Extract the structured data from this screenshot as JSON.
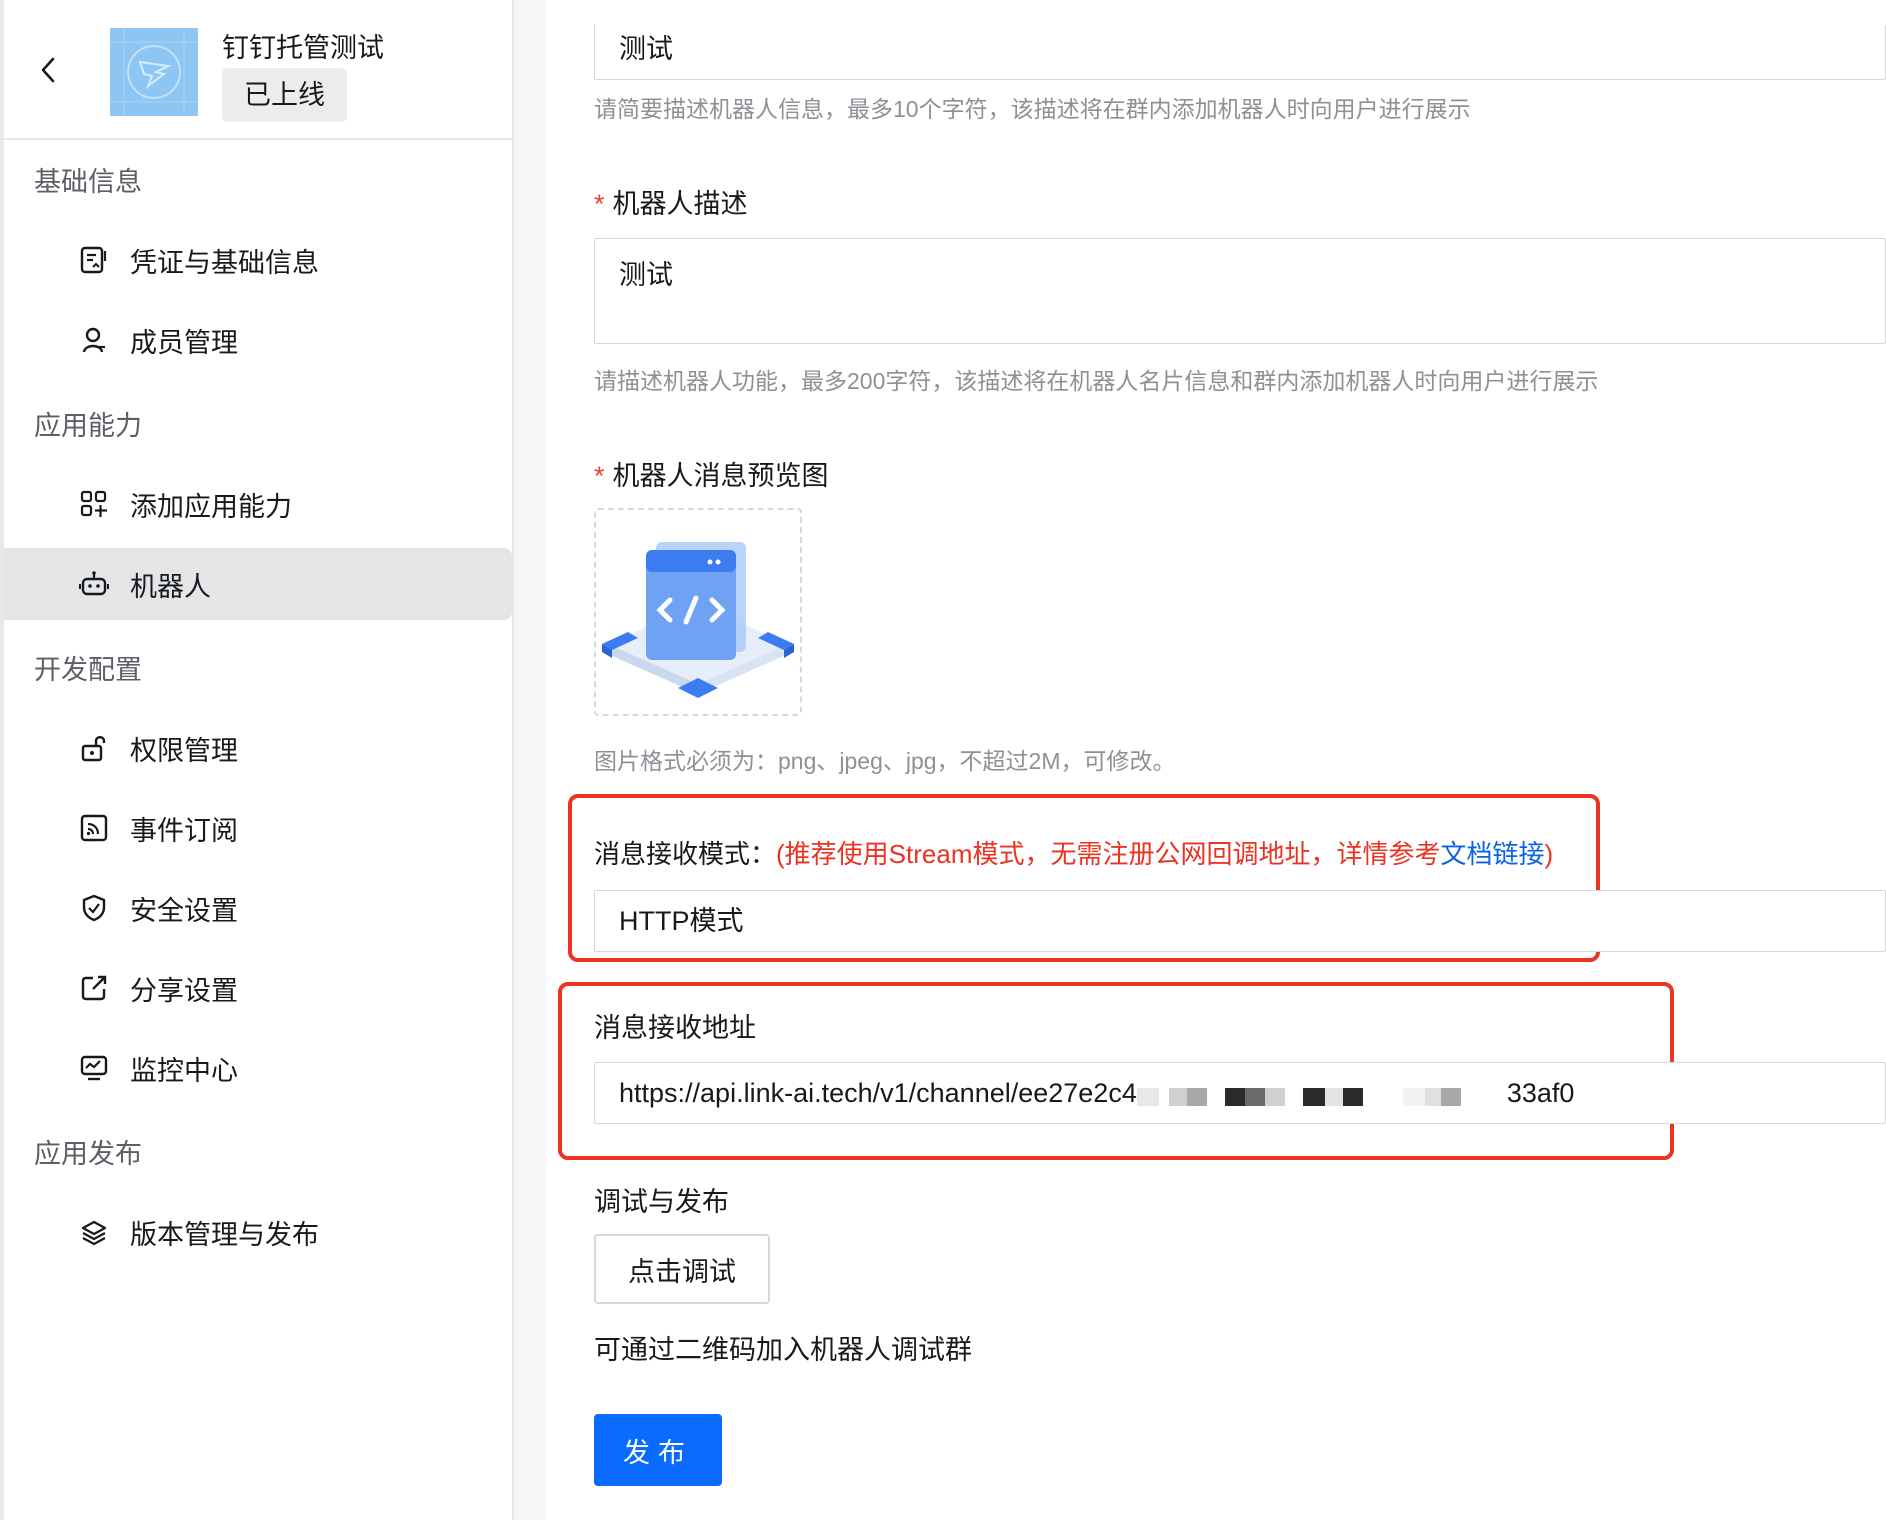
{
  "app": {
    "name": "钉钉托管测试",
    "status": "已上线"
  },
  "sidebar": {
    "sections": [
      {
        "title": "基础信息",
        "items": [
          {
            "label": "凭证与基础信息",
            "icon": "credential-icon"
          },
          {
            "label": "成员管理",
            "icon": "user-icon"
          }
        ]
      },
      {
        "title": "应用能力",
        "items": [
          {
            "label": "添加应用能力",
            "icon": "apps-add-icon"
          },
          {
            "label": "机器人",
            "icon": "robot-icon"
          }
        ]
      },
      {
        "title": "开发配置",
        "items": [
          {
            "label": "权限管理",
            "icon": "lock-icon"
          },
          {
            "label": "事件订阅",
            "icon": "rss-icon"
          },
          {
            "label": "安全设置",
            "icon": "shield-icon"
          },
          {
            "label": "分享设置",
            "icon": "share-icon"
          },
          {
            "label": "监控中心",
            "icon": "monitor-icon"
          }
        ]
      },
      {
        "title": "应用发布",
        "items": [
          {
            "label": "版本管理与发布",
            "icon": "layers-icon"
          }
        ]
      }
    ],
    "active": "机器人"
  },
  "form": {
    "brief_value": "测试",
    "brief_hint": "请简要描述机器人信息，最多10个字符，该描述将在群内添加机器人时向用户进行展示",
    "desc_label": "机器人描述",
    "desc_value": "测试",
    "desc_hint": "请描述机器人功能，最多200字符，该描述将在机器人名片信息和群内添加机器人时向用户进行展示",
    "preview_label": "机器人消息预览图",
    "preview_hint": "图片格式必须为：png、jpeg、jpg，不超过2M，可修改。",
    "mode_label": "消息接收模式：",
    "mode_note_prefix": "(推荐使用Stream模式，无需注册公网回调地址，详情参考",
    "mode_note_link": "文档链接",
    "mode_note_suffix": ")",
    "mode_value": "HTTP模式",
    "url_label": "消息接收地址",
    "url_value_start": "https://api.link-ai.tech/v1/channel/ee27e2c4",
    "url_value_end": "33af0",
    "debug_label": "调试与发布",
    "debug_button": "点击调试",
    "qr_text": "可通过二维码加入机器人调试群",
    "publish_button": "发布"
  },
  "colors": {
    "highlight": "#ea3323",
    "primary": "#0a6cff",
    "link": "#0a63e6"
  }
}
